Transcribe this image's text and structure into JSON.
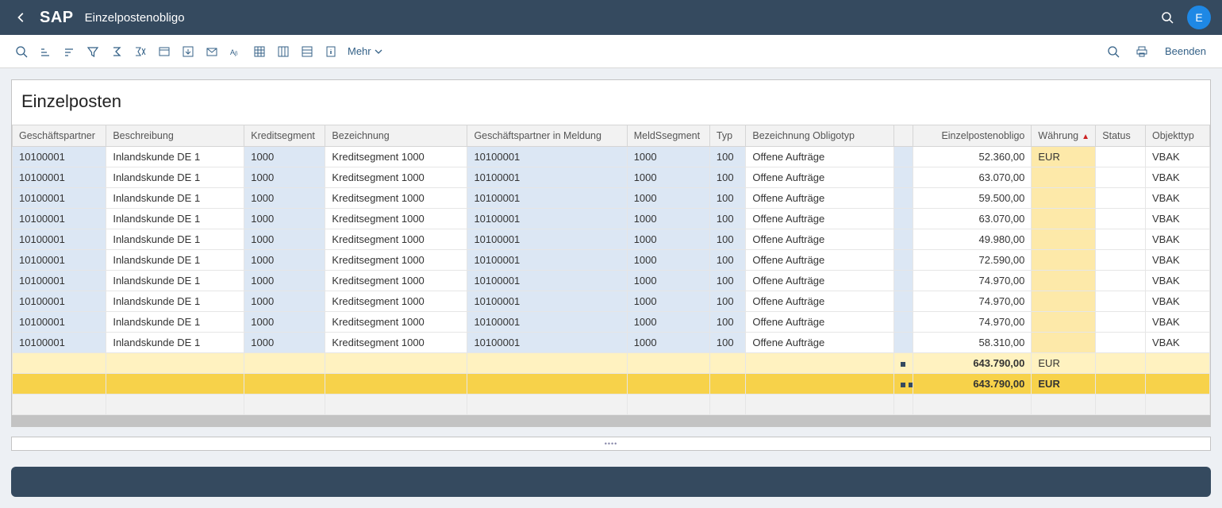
{
  "header": {
    "logo": "SAP",
    "title": "Einzelpostenobligo",
    "avatar_initial": "E"
  },
  "toolbar": {
    "more_label": "Mehr",
    "exit_label": "Beenden"
  },
  "panel": {
    "title": "Einzelposten"
  },
  "table": {
    "columns": [
      {
        "key": "gp",
        "label": "Geschäftspartner",
        "w": 117,
        "shade": true
      },
      {
        "key": "besch",
        "label": "Beschreibung",
        "w": 172
      },
      {
        "key": "kseg",
        "label": "Kreditsegment",
        "w": 101,
        "shade": true
      },
      {
        "key": "bez",
        "label": "Bezeichnung",
        "w": 177
      },
      {
        "key": "gpm",
        "label": "Geschäftspartner in Meldung",
        "w": 199,
        "shade": true
      },
      {
        "key": "msseg",
        "label": "MeldSsegment",
        "w": 103,
        "shade": true
      },
      {
        "key": "typ",
        "label": "Typ",
        "w": 45,
        "shade": true
      },
      {
        "key": "bezot",
        "label": "Bezeichnung Obligotyp",
        "w": 185
      },
      {
        "key": "flag",
        "label": "",
        "w": 23,
        "shade": true
      },
      {
        "key": "ep",
        "label": "Einzelpostenobligo",
        "w": 148,
        "num": true
      },
      {
        "key": "wkz",
        "label": "Währung",
        "w": 80,
        "cur": true,
        "sorted": true
      },
      {
        "key": "status",
        "label": "Status",
        "w": 62
      },
      {
        "key": "otyp",
        "label": "Objekttyp",
        "w": 80
      }
    ],
    "rows": [
      {
        "gp": "10100001",
        "besch": "Inlandskunde DE 1",
        "kseg": "1000",
        "bez": "Kreditsegment 1000",
        "gpm": "10100001",
        "msseg": "1000",
        "typ": "100",
        "bezot": "Offene Aufträge",
        "flag": "",
        "ep": "52.360,00",
        "wkz": "EUR",
        "status": "",
        "otyp": "VBAK"
      },
      {
        "gp": "10100001",
        "besch": "Inlandskunde DE 1",
        "kseg": "1000",
        "bez": "Kreditsegment 1000",
        "gpm": "10100001",
        "msseg": "1000",
        "typ": "100",
        "bezot": "Offene Aufträge",
        "flag": "",
        "ep": "63.070,00",
        "wkz": "",
        "status": "",
        "otyp": "VBAK"
      },
      {
        "gp": "10100001",
        "besch": "Inlandskunde DE 1",
        "kseg": "1000",
        "bez": "Kreditsegment 1000",
        "gpm": "10100001",
        "msseg": "1000",
        "typ": "100",
        "bezot": "Offene Aufträge",
        "flag": "",
        "ep": "59.500,00",
        "wkz": "",
        "status": "",
        "otyp": "VBAK"
      },
      {
        "gp": "10100001",
        "besch": "Inlandskunde DE 1",
        "kseg": "1000",
        "bez": "Kreditsegment 1000",
        "gpm": "10100001",
        "msseg": "1000",
        "typ": "100",
        "bezot": "Offene Aufträge",
        "flag": "",
        "ep": "63.070,00",
        "wkz": "",
        "status": "",
        "otyp": "VBAK"
      },
      {
        "gp": "10100001",
        "besch": "Inlandskunde DE 1",
        "kseg": "1000",
        "bez": "Kreditsegment 1000",
        "gpm": "10100001",
        "msseg": "1000",
        "typ": "100",
        "bezot": "Offene Aufträge",
        "flag": "",
        "ep": "49.980,00",
        "wkz": "",
        "status": "",
        "otyp": "VBAK"
      },
      {
        "gp": "10100001",
        "besch": "Inlandskunde DE 1",
        "kseg": "1000",
        "bez": "Kreditsegment 1000",
        "gpm": "10100001",
        "msseg": "1000",
        "typ": "100",
        "bezot": "Offene Aufträge",
        "flag": "",
        "ep": "72.590,00",
        "wkz": "",
        "status": "",
        "otyp": "VBAK"
      },
      {
        "gp": "10100001",
        "besch": "Inlandskunde DE 1",
        "kseg": "1000",
        "bez": "Kreditsegment 1000",
        "gpm": "10100001",
        "msseg": "1000",
        "typ": "100",
        "bezot": "Offene Aufträge",
        "flag": "",
        "ep": "74.970,00",
        "wkz": "",
        "status": "",
        "otyp": "VBAK"
      },
      {
        "gp": "10100001",
        "besch": "Inlandskunde DE 1",
        "kseg": "1000",
        "bez": "Kreditsegment 1000",
        "gpm": "10100001",
        "msseg": "1000",
        "typ": "100",
        "bezot": "Offene Aufträge",
        "flag": "",
        "ep": "74.970,00",
        "wkz": "",
        "status": "",
        "otyp": "VBAK"
      },
      {
        "gp": "10100001",
        "besch": "Inlandskunde DE 1",
        "kseg": "1000",
        "bez": "Kreditsegment 1000",
        "gpm": "10100001",
        "msseg": "1000",
        "typ": "100",
        "bezot": "Offene Aufträge",
        "flag": "",
        "ep": "74.970,00",
        "wkz": "",
        "status": "",
        "otyp": "VBAK"
      },
      {
        "gp": "10100001",
        "besch": "Inlandskunde DE 1",
        "kseg": "1000",
        "bez": "Kreditsegment 1000",
        "gpm": "10100001",
        "msseg": "1000",
        "typ": "100",
        "bezot": "Offene Aufträge",
        "flag": "",
        "ep": "58.310,00",
        "wkz": "",
        "status": "",
        "otyp": "VBAK"
      }
    ],
    "subtotal": {
      "ep": "643.790,00",
      "wkz": "EUR"
    },
    "grandtotal": {
      "ep": "643.790,00",
      "wkz": "EUR"
    }
  }
}
